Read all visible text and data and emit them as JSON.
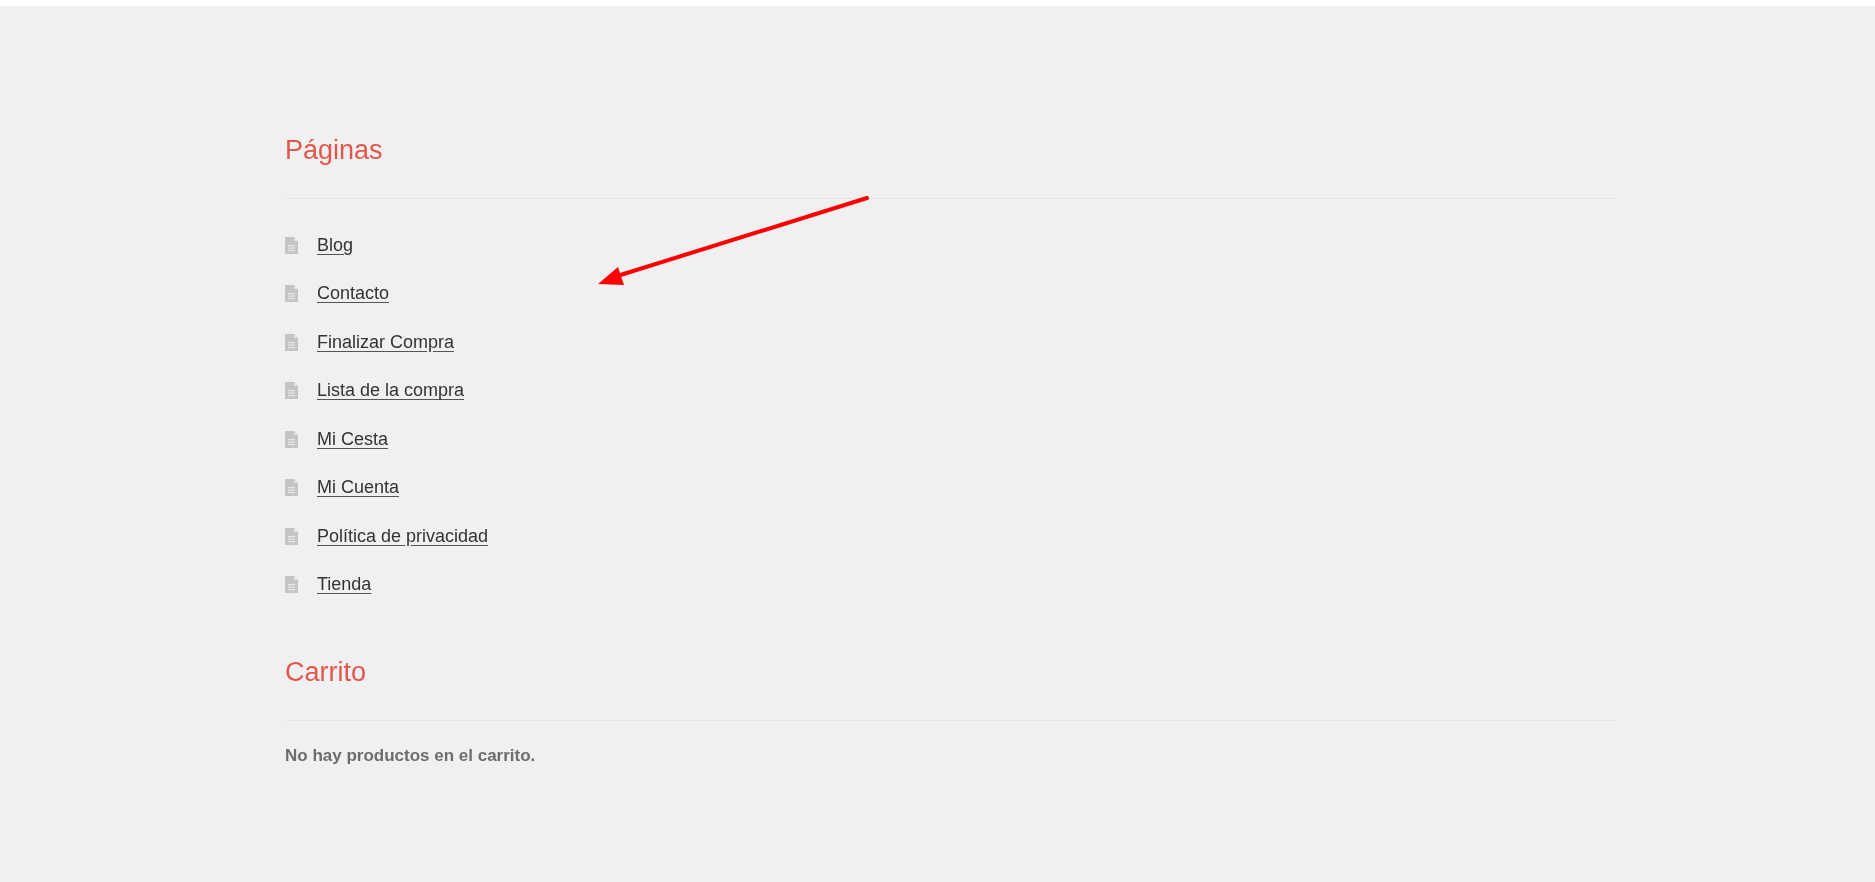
{
  "sections": [
    {
      "kind": "links",
      "title": "Páginas",
      "items": [
        "Blog",
        "Contacto",
        "Finalizar Compra",
        "Lista de la compra",
        "Mi Cesta",
        "Mi Cuenta",
        "Política de privacidad",
        "Tienda"
      ]
    },
    {
      "kind": "text",
      "title": "Carrito",
      "text": "No hay productos en el carrito."
    }
  ]
}
